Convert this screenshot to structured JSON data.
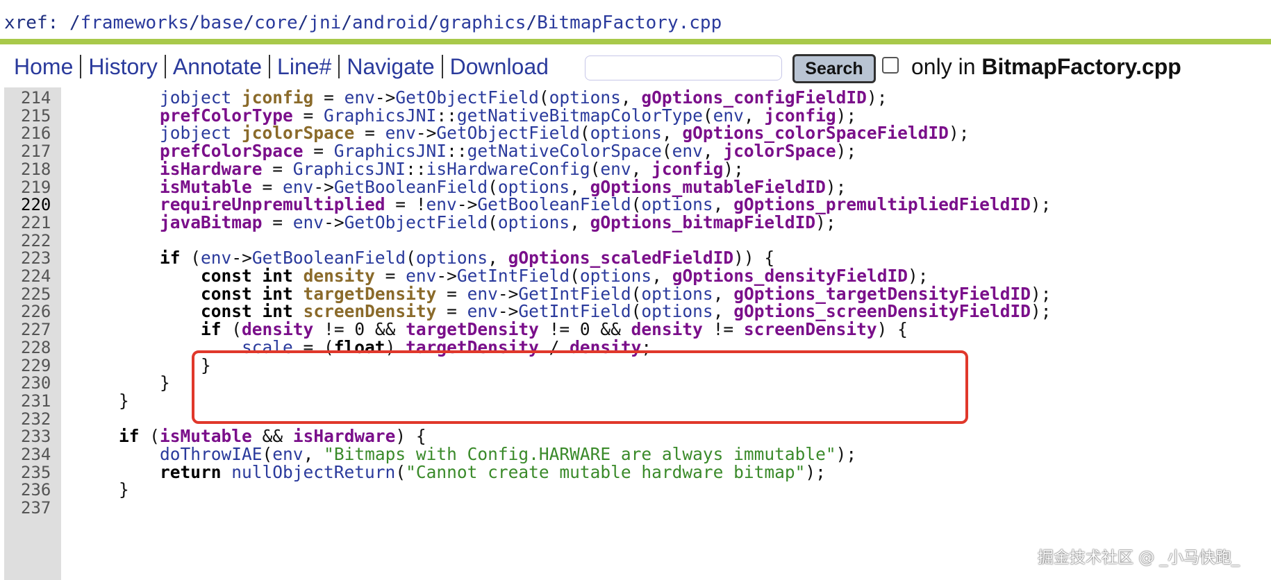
{
  "header": {
    "xref_label": "xref",
    "crumbs": [
      "frameworks",
      "base",
      "core",
      "jni",
      "android",
      "graphics",
      "BitmapFactory.cpp"
    ]
  },
  "nav": {
    "items": [
      "Home",
      "History",
      "Annotate",
      "Line#",
      "Navigate",
      "Download"
    ],
    "search_value": "",
    "search_button": "Search",
    "only_in_prefix": "only in ",
    "only_in_file": "BitmapFactory.cpp"
  },
  "code": {
    "current_line": 220,
    "lines": [
      {
        "n": "214",
        "t": "        jobject jconfig = env->GetObjectField(options, gOptions_configFieldID);"
      },
      {
        "n": "215",
        "t": "        prefColorType = GraphicsJNI::getNativeBitmapColorType(env, jconfig);"
      },
      {
        "n": "216",
        "t": "        jobject jcolorSpace = env->GetObjectField(options, gOptions_colorSpaceFieldID);"
      },
      {
        "n": "217",
        "t": "        prefColorSpace = GraphicsJNI::getNativeColorSpace(env, jcolorSpace);"
      },
      {
        "n": "218",
        "t": "        isHardware = GraphicsJNI::isHardwareConfig(env, jconfig);"
      },
      {
        "n": "219",
        "t": "        isMutable = env->GetBooleanField(options, gOptions_mutableFieldID);"
      },
      {
        "n": "220",
        "t": "        requireUnpremultiplied = !env->GetBooleanField(options, gOptions_premultipliedFieldID);"
      },
      {
        "n": "221",
        "t": "        javaBitmap = env->GetObjectField(options, gOptions_bitmapFieldID);"
      },
      {
        "n": "222",
        "t": ""
      },
      {
        "n": "223",
        "t": "        if (env->GetBooleanField(options, gOptions_scaledFieldID)) {"
      },
      {
        "n": "224",
        "t": "            const int density = env->GetIntField(options, gOptions_densityFieldID);"
      },
      {
        "n": "225",
        "t": "            const int targetDensity = env->GetIntField(options, gOptions_targetDensityFieldID);"
      },
      {
        "n": "226",
        "t": "            const int screenDensity = env->GetIntField(options, gOptions_screenDensityFieldID);"
      },
      {
        "n": "227",
        "t": "            if (density != 0 && targetDensity != 0 && density != screenDensity) {"
      },
      {
        "n": "228",
        "t": "                scale = (float) targetDensity / density;"
      },
      {
        "n": "229",
        "t": "            }"
      },
      {
        "n": "230",
        "t": "        }"
      },
      {
        "n": "231",
        "t": "    }"
      },
      {
        "n": "232",
        "t": ""
      },
      {
        "n": "233",
        "t": "    if (isMutable && isHardware) {"
      },
      {
        "n": "234",
        "t": "        doThrowIAE(env, \"Bitmaps with Config.HARWARE are always immutable\");"
      },
      {
        "n": "235",
        "t": "        return nullObjectReturn(\"Cannot create mutable hardware bitmap\");"
      },
      {
        "n": "236",
        "t": "    }"
      },
      {
        "n": "237",
        "t": ""
      }
    ]
  },
  "watermark": "掘金技术社区 @ _小马快跑_"
}
